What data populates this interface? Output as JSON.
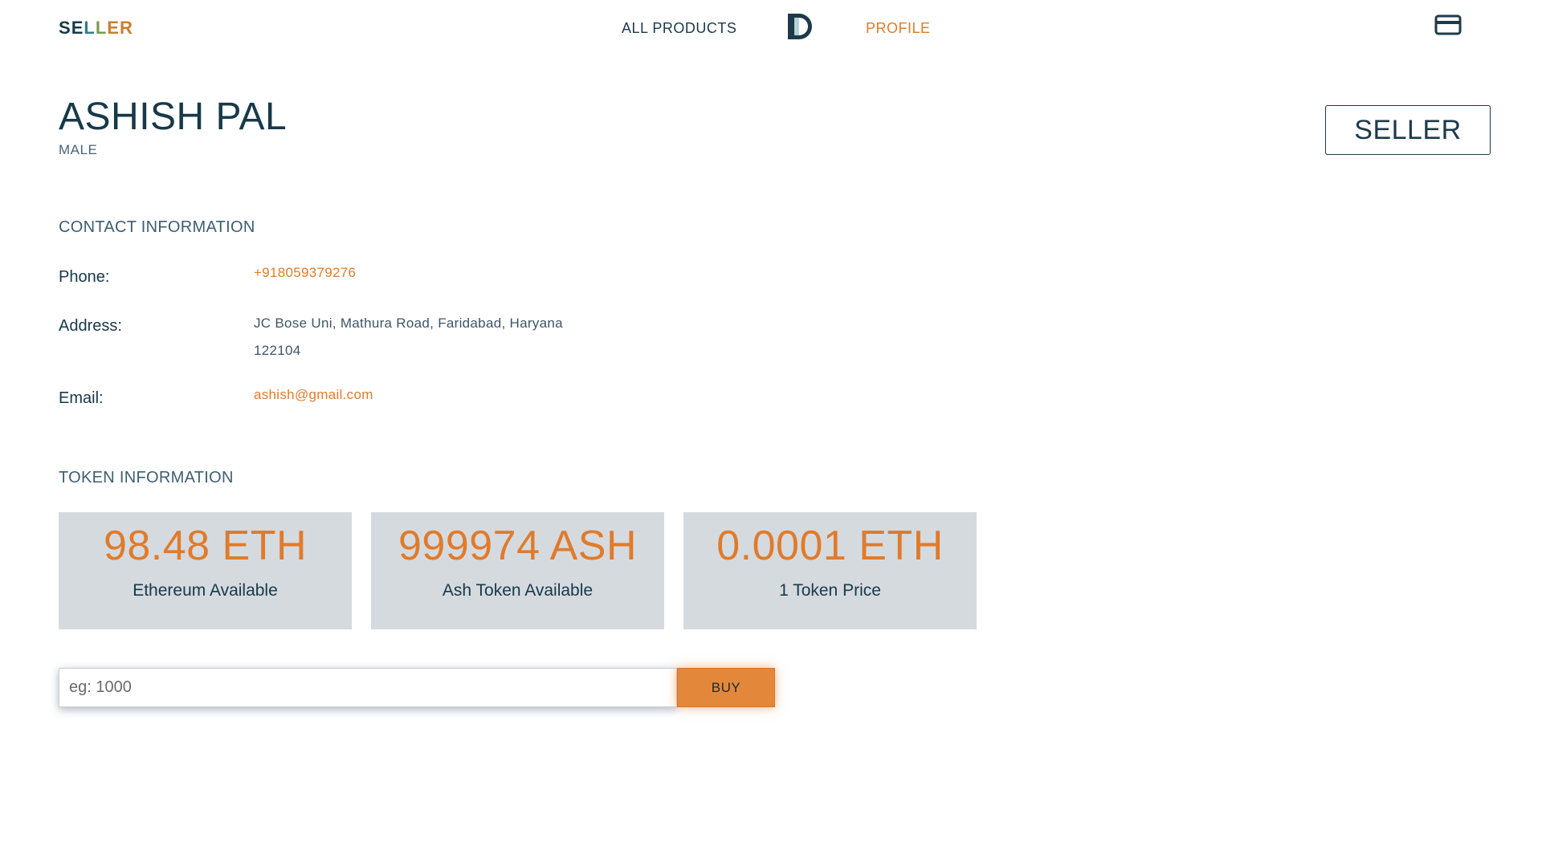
{
  "header": {
    "brand_letters": [
      "S",
      "E",
      "L",
      "L",
      "E",
      "R"
    ],
    "brand_colors": [
      "#17394a",
      "#17394a",
      "#2f7f86",
      "#7d9a4a",
      "#c8802e",
      "#c8802e"
    ],
    "nav": {
      "all_products": "ALL PRODUCTS",
      "profile": "PROFILE"
    },
    "logo_icon": "d-letter-logo-icon",
    "wallet_icon": "credit-card-icon"
  },
  "profile": {
    "name": "ASHISH PAL",
    "gender": "MALE",
    "role": "SELLER"
  },
  "contact": {
    "title": "CONTACT INFORMATION",
    "phone_label": "Phone:",
    "phone": "+918059379276",
    "address_label": "Address:",
    "address_line1": "JC Bose Uni, Mathura Road, Faridabad, Haryana",
    "address_line2": "122104",
    "email_label": "Email:",
    "email": "ashish@gmail.com"
  },
  "token": {
    "title": "TOKEN INFORMATION",
    "cards": [
      {
        "amount": "98.48 ETH",
        "caption": "Ethereum Available"
      },
      {
        "amount": "999974 ASH",
        "caption": "Ash Token Available"
      },
      {
        "amount": "0.0001 ETH",
        "caption": "1 Token Price"
      }
    ]
  },
  "buy": {
    "placeholder": "eg: 1000",
    "button": "BUY"
  },
  "colors": {
    "accent": "#e07b2b",
    "primary_text": "#17394a",
    "card_bg": "#d5dadf"
  }
}
